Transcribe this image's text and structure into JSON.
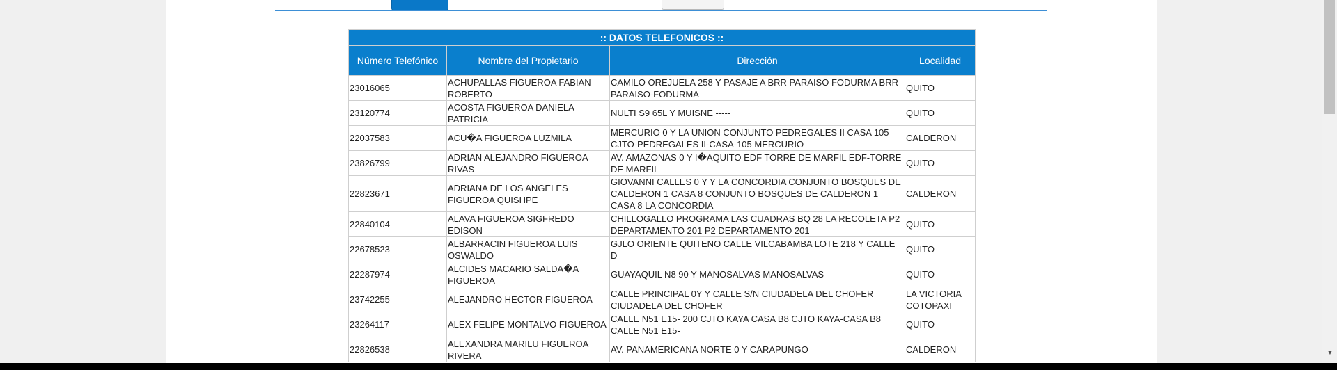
{
  "table": {
    "caption": ":: DATOS TELEFONICOS ::",
    "headers": [
      "Número Telefónico",
      "Nombre del Propietario",
      "Dirección",
      "Localidad"
    ],
    "rows": [
      {
        "numero": "23016065",
        "nombre": "ACHUPALLAS FIGUEROA FABIAN ROBERTO",
        "direccion": "CAMILO OREJUELA 258 Y PASAJE A BRR PARAISO FODURMA BRR PARAISO-FODURMA",
        "localidad": "QUITO"
      },
      {
        "numero": "23120774",
        "nombre": "ACOSTA FIGUEROA DANIELA PATRICIA",
        "direccion": "NULTI S9 65L Y MUISNE -----",
        "localidad": "QUITO"
      },
      {
        "numero": "22037583",
        "nombre": "ACU�A FIGUEROA LUZMILA",
        "direccion": "MERCURIO 0 Y LA UNION CONJUNTO PEDREGALES II CASA 105 CJTO-PEDREGALES II-CASA-105 MERCURIO",
        "localidad": "CALDERON"
      },
      {
        "numero": "23826799",
        "nombre": "ADRIAN ALEJANDRO FIGUEROA RIVAS",
        "direccion": "AV. AMAZONAS 0 Y I�AQUITO EDF TORRE DE MARFIL EDF-TORRE DE MARFIL",
        "localidad": "QUITO"
      },
      {
        "numero": "22823671",
        "nombre": "ADRIANA DE LOS ANGELES FIGUEROA QUISHPE",
        "direccion": "GIOVANNI CALLES 0 Y Y LA CONCORDIA CONJUNTO BOSQUES DE CALDERON 1 CASA 8 CONJUNTO BOSQUES DE CALDERON 1 CASA 8 LA CONCORDIA",
        "localidad": "CALDERON"
      },
      {
        "numero": "22840104",
        "nombre": "ALAVA FIGUEROA SIGFREDO EDISON",
        "direccion": "CHILLOGALLO PROGRAMA LAS CUADRAS BQ 28 LA RECOLETA P2 DEPARTAMENTO 201 P2 DEPARTAMENTO 201",
        "localidad": "QUITO"
      },
      {
        "numero": "22678523",
        "nombre": "ALBARRACIN FIGUEROA LUIS OSWALDO",
        "direccion": "GJLO ORIENTE QUITENO CALLE VILCABAMBA LOTE 218 Y CALLE D",
        "localidad": "QUITO"
      },
      {
        "numero": "22287974",
        "nombre": "ALCIDES MACARIO SALDA�A FIGUEROA",
        "direccion": "GUAYAQUIL N8 90 Y MANOSALVAS MANOSALVAS",
        "localidad": "QUITO"
      },
      {
        "numero": "23742255",
        "nombre": "ALEJANDRO HECTOR FIGUEROA",
        "direccion": "CALLE PRINCIPAL 0Y Y CALLE S/N CIUDADELA DEL CHOFER CIUDADELA DEL CHOFER",
        "localidad": "LA VICTORIA COTOPAXI"
      },
      {
        "numero": "23264117",
        "nombre": "ALEX FELIPE MONTALVO FIGUEROA",
        "direccion": "CALLE N51 E15- 200 CJTO KAYA CASA B8 CJTO KAYA-CASA B8 CALLE N51 E15-",
        "localidad": "QUITO"
      },
      {
        "numero": "22826538",
        "nombre": "ALEXANDRA MARILU FIGUEROA RIVERA",
        "direccion": "AV. PANAMERICANA NORTE 0 Y CARAPUNGO",
        "localidad": "CALDERON"
      }
    ]
  },
  "colors": {
    "header_bg": "#0a7fcd",
    "accent_rule": "#3d8fd6",
    "page_bg": "#f0f0f0"
  }
}
